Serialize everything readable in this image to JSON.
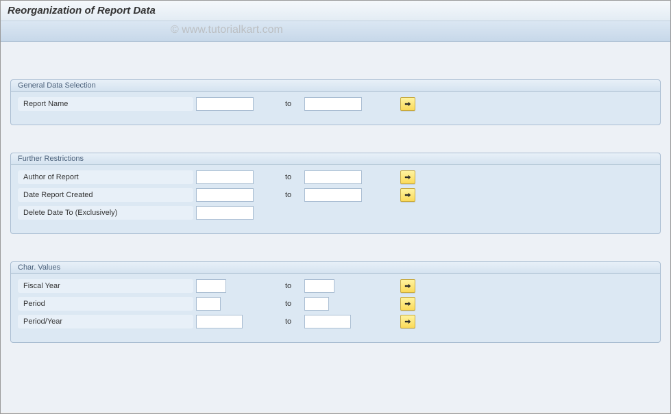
{
  "page": {
    "title": "Reorganization of Report Data"
  },
  "watermark": "© www.tutorialkart.com",
  "sections": {
    "general": {
      "header": "General Data Selection",
      "report_name": {
        "label": "Report Name",
        "from": "",
        "to_label": "to",
        "to": ""
      }
    },
    "further": {
      "header": "Further Restrictions",
      "author": {
        "label": "Author of Report",
        "from": "",
        "to_label": "to",
        "to": ""
      },
      "date_created": {
        "label": "Date Report Created",
        "from": "",
        "to_label": "to",
        "to": ""
      },
      "delete_date": {
        "label": "Delete Date To (Exclusively)",
        "value": ""
      }
    },
    "char_values": {
      "header": "Char. Values",
      "fiscal_year": {
        "label": "Fiscal Year",
        "from": "",
        "to_label": "to",
        "to": ""
      },
      "period": {
        "label": "Period",
        "from": "",
        "to_label": "to",
        "to": ""
      },
      "period_year": {
        "label": "Period/Year",
        "from": "",
        "to_label": "to",
        "to": ""
      }
    }
  }
}
